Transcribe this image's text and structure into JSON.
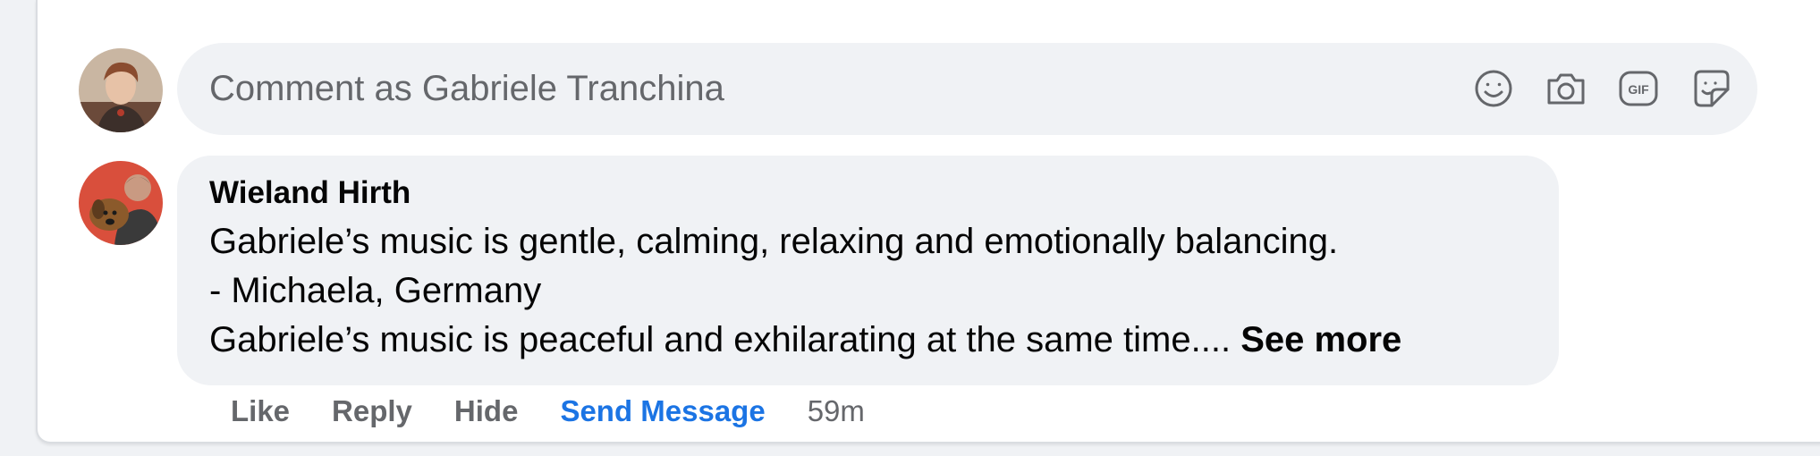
{
  "composer": {
    "placeholder": "Comment as Gabriele Tranchina",
    "icons": [
      "emoji-icon",
      "camera-icon",
      "gif-icon",
      "sticker-icon"
    ],
    "gif_label": "GIF"
  },
  "comment": {
    "author": "Wieland Hirth",
    "lines": [
      "Gabriele’s music is gentle, calming, relaxing and emotionally balancing.",
      "- Michaela, Germany",
      "Gabriele’s music is peaceful and exhilarating at the same time...."
    ],
    "see_more": "See more",
    "actions": {
      "like": "Like",
      "reply": "Reply",
      "hide": "Hide",
      "send_message": "Send Message"
    },
    "timestamp": "59m"
  },
  "colors": {
    "link_blue": "#1b74e4",
    "bubble_bg": "#f0f2f5",
    "secondary_text": "#65676b"
  }
}
